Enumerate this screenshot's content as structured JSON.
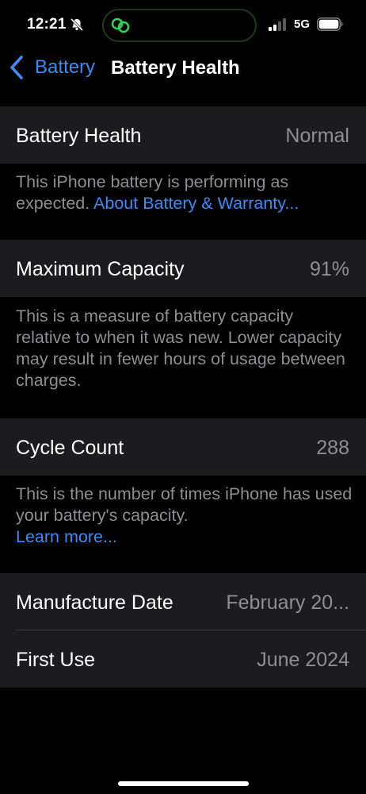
{
  "status_bar": {
    "time": "12:21",
    "network": "5G"
  },
  "nav": {
    "back_label": "Battery",
    "title": "Battery Health"
  },
  "sections": {
    "health": {
      "label": "Battery Health",
      "value": "Normal",
      "footer_text": "This iPhone battery is performing as expected. ",
      "footer_link": "About Battery & Warranty..."
    },
    "capacity": {
      "label": "Maximum Capacity",
      "value": "91%",
      "footer_text": "This is a measure of battery capacity relative to when it was new. Lower capacity may result in fewer hours of usage between charges."
    },
    "cycles": {
      "label": "Cycle Count",
      "value": "288",
      "footer_text": "This is the number of times iPhone has used your battery's capacity.",
      "footer_link": "Learn more..."
    },
    "dates": {
      "manufacture_label": "Manufacture Date",
      "manufacture_value": "February 20...",
      "first_use_label": "First Use",
      "first_use_value": "June 2024"
    }
  },
  "colors": {
    "accent": "#3b8cf5",
    "group_background": "#1c1c1e",
    "secondary_text": "#8e8e93",
    "background": "#000000"
  },
  "icons": {
    "bell": "bell-slash-icon",
    "island": "linked-rings-icon",
    "signal": "cellular-signal-icon",
    "battery": "battery-icon",
    "back": "chevron-left-icon"
  }
}
